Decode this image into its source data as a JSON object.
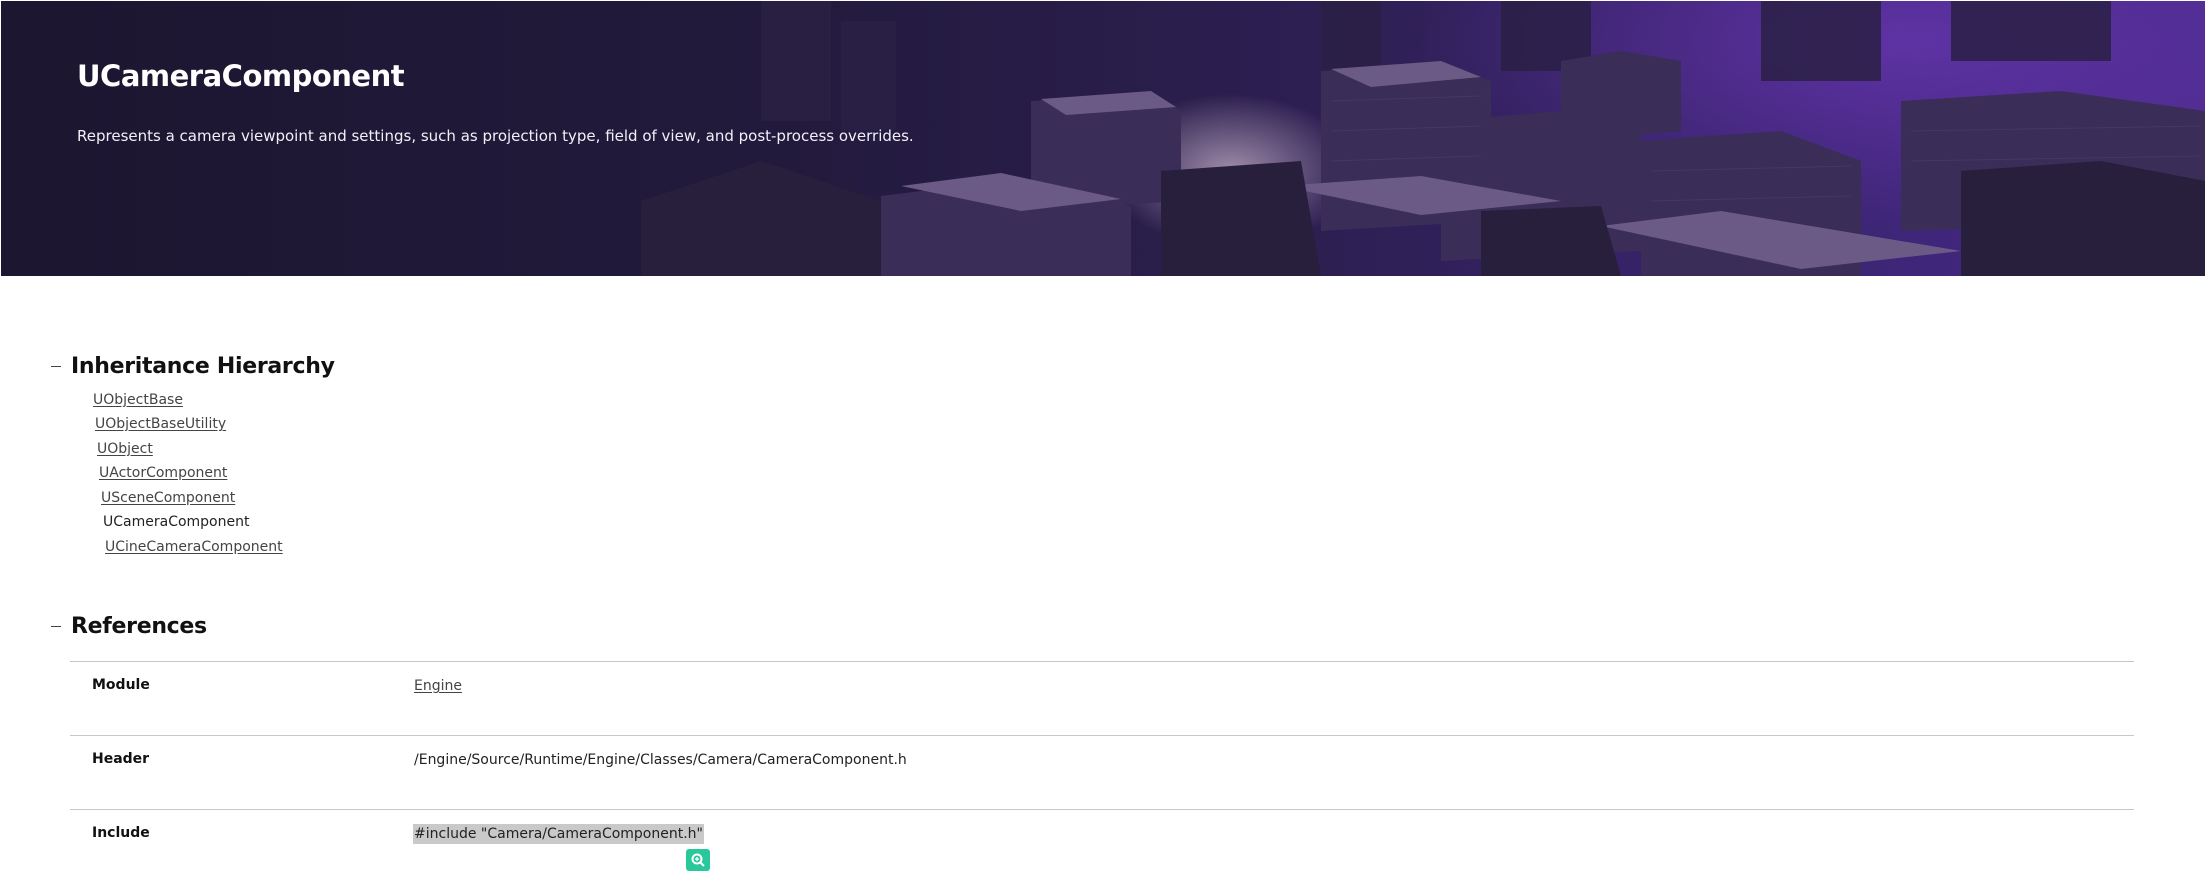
{
  "hero": {
    "title": "UCameraComponent",
    "description": "Represents a camera viewpoint and settings, such as projection type, field of view, and post-process overrides."
  },
  "sections": {
    "inheritance": {
      "title": "Inheritance Hierarchy",
      "items": [
        {
          "label": "UObjectBase",
          "link": true
        },
        {
          "label": "UObjectBaseUtility",
          "link": true
        },
        {
          "label": "UObject",
          "link": true
        },
        {
          "label": "UActorComponent",
          "link": true
        },
        {
          "label": "USceneComponent",
          "link": true
        },
        {
          "label": "UCameraComponent",
          "link": false
        },
        {
          "label": "UCineCameraComponent",
          "link": true
        }
      ]
    },
    "references": {
      "title": "References",
      "rows": [
        {
          "label": "Module",
          "value": "Engine"
        },
        {
          "label": "Header",
          "value": "/Engine/Source/Runtime/Engine/Classes/Camera/CameraComponent.h"
        },
        {
          "label": "Include",
          "value": "#include \"Camera/CameraComponent.h\""
        }
      ]
    }
  },
  "icons": {
    "collapse": "minus-icon",
    "copy": "search-plus-icon"
  },
  "colors": {
    "hero_dark": "#1c1630",
    "hero_purple": "#4a2a8a",
    "copy_button": "#28c89a",
    "selection": "#c9c9c9"
  }
}
